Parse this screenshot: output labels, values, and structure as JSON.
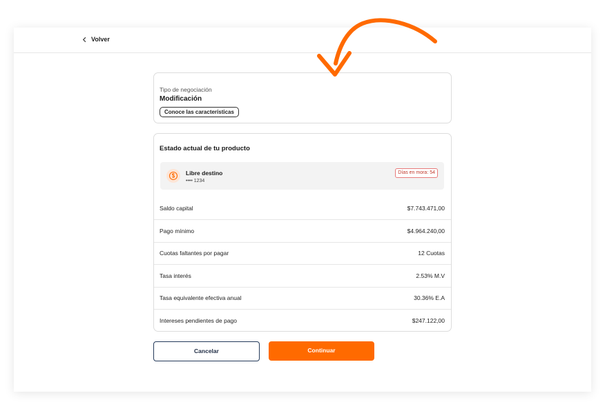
{
  "topbar": {
    "back_label": "Volver"
  },
  "negotiation": {
    "type_label": "Tipo de negociación",
    "type_value": "Modificación",
    "features_button": "Conoce las características"
  },
  "product_status": {
    "heading": "Estado actual de tu producto",
    "product": {
      "name": "Libre destino",
      "number": "•••• 1234",
      "badge": "Días en mora: 54",
      "icon": "dollar-coin-icon"
    },
    "rows": [
      {
        "label": "Saldo capital",
        "value": "$7.743.471,00"
      },
      {
        "label": "Pago mínimo",
        "value": "$4.964.240,00"
      },
      {
        "label": "Cuotas faltantes por pagar",
        "value": "12 Cuotas"
      },
      {
        "label": "Tasa interés",
        "value": "2.53% M.V"
      },
      {
        "label": "Tasa equivalente efectiva anual",
        "value": "30.36% E.A"
      },
      {
        "label": "Intereses pendientes de pago",
        "value": "$247.122,00"
      }
    ]
  },
  "actions": {
    "cancel_label": "Cancelar",
    "continue_label": "Continuar"
  },
  "colors": {
    "accent": "#ff6a00",
    "annotation_arrow": "#ff6a00",
    "badge_text": "#c0392b",
    "outline_button": "#243a5a"
  }
}
